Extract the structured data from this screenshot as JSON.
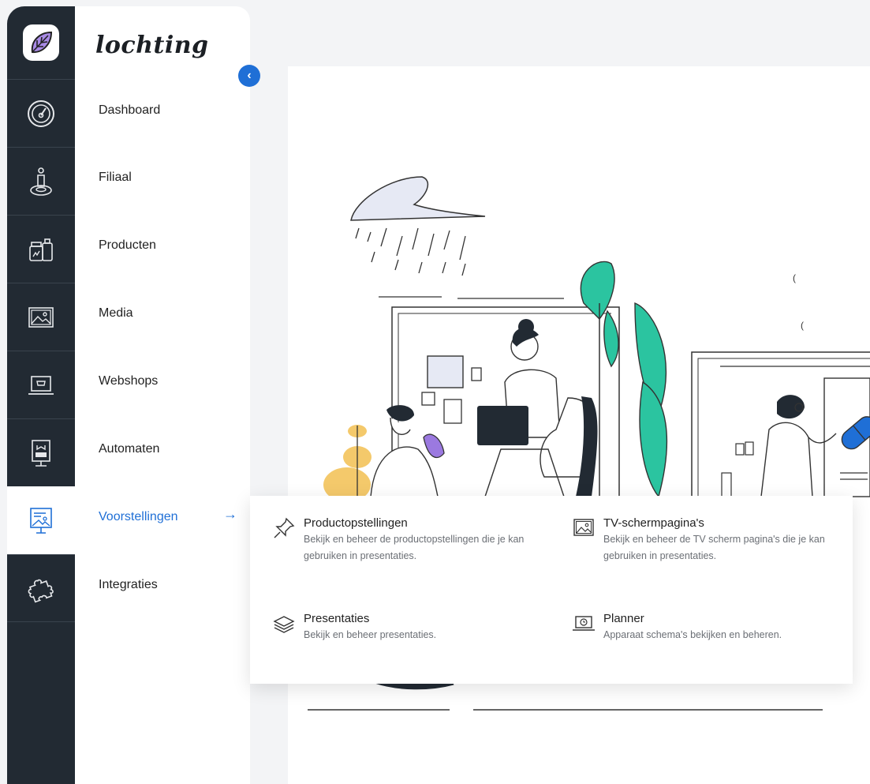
{
  "brand": {
    "name": "lochting"
  },
  "rail": {
    "icons": [
      "leaf-logo-icon",
      "speedometer-icon",
      "person-location-icon",
      "products-icon",
      "media-icon",
      "webshop-icon",
      "vending-machine-icon",
      "presentation-icon",
      "puzzle-icon"
    ]
  },
  "nav": {
    "items": [
      {
        "label": "Dashboard"
      },
      {
        "label": "Filiaal"
      },
      {
        "label": "Producten"
      },
      {
        "label": "Media"
      },
      {
        "label": "Webshops"
      },
      {
        "label": "Automaten"
      },
      {
        "label": "Voorstellingen"
      },
      {
        "label": "Integraties"
      }
    ],
    "active_index": 6
  },
  "dropdown": {
    "items": [
      {
        "title": "Productopstellingen",
        "description": "Bekijk en beheer de productopstellingen die je kan gebruiken in presentaties.",
        "icon": "pin-icon"
      },
      {
        "title": "TV-schermpagina's",
        "description": "Bekijk en beheer de TV scherm pagina's die je kan gebruiken in presentaties.",
        "icon": "image-icon"
      },
      {
        "title": "Presentaties",
        "description": "Bekijk en beheer presentaties.",
        "icon": "layers-icon"
      },
      {
        "title": "Planner",
        "description": "Apparaat schema's bekijken en beheren.",
        "icon": "laptop-clock-icon"
      }
    ]
  },
  "colors": {
    "accent": "#1f6fd6",
    "rail": "#222a33",
    "teal": "#2bc4a0",
    "purple": "#9b79e0",
    "yellow": "#f4c96b"
  }
}
